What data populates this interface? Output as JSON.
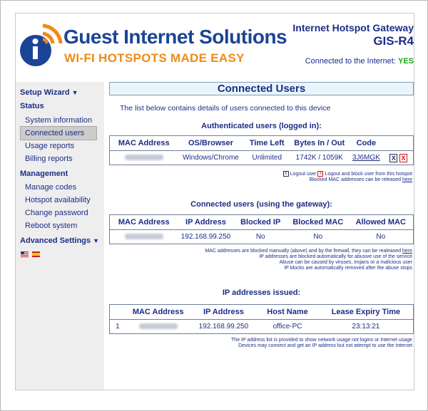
{
  "header": {
    "brand": "Guest Internet Solutions",
    "tagline": "WI-FI HOTSPOTS MADE EASY",
    "product": "Internet Hotspot Gateway",
    "model": "GIS-R4",
    "connected_label": "Connected to the Internet:",
    "connected_value": "YES"
  },
  "sidebar": {
    "setup_wizard": "Setup Wizard",
    "status_heading": "Status",
    "status_items": [
      "System information",
      "Connected users",
      "Usage reports",
      "Billing reports"
    ],
    "management_heading": "Management",
    "management_items": [
      "Manage codes",
      "Hotspot availability",
      "Change password",
      "Reboot system"
    ],
    "advanced": "Advanced Settings"
  },
  "page": {
    "title": "Connected Users",
    "intro": "The list below contains details of users connected to this device"
  },
  "authenticated": {
    "heading": "Authenticated users (logged in):",
    "columns": [
      "MAC Address",
      "OS/Browser",
      "Time Left",
      "Bytes In / Out",
      "Code"
    ],
    "row": {
      "os": "Windows/Chrome",
      "time_left": "Unlimited",
      "bytes": "1742K / 1059K",
      "code": "3J6MGK"
    },
    "note_logout": "Logout user",
    "note_block": "Logout and block user from this hotspot",
    "note_released": "Blocked MAC addresses can be released",
    "note_link": "here"
  },
  "gateway": {
    "heading": "Connected users (using the gateway):",
    "columns": [
      "MAC Address",
      "IP Address",
      "Blocked IP",
      "Blocked MAC",
      "Allowed MAC"
    ],
    "row": {
      "ip": "192.168.99.250",
      "blocked_ip": "No",
      "blocked_mac": "No",
      "allowed_mac": "No"
    },
    "notes": [
      "MAC addresses are blocked manually (above) and by the firewall, they can be realeased",
      "IP addresses are blocked automatically for abusive use of the service",
      "Abuse can be caused by viruses, trojans or a malicious user",
      "IP blocks are automatically removed after the abuse stops"
    ],
    "note_link": "here"
  },
  "issued": {
    "heading": "IP addresses issued:",
    "columns": [
      "MAC Address",
      "IP Address",
      "Host Name",
      "Lease Expiry Time"
    ],
    "row": {
      "index": "1",
      "ip": "192.168.99.250",
      "host": "office-PC",
      "expiry": "23:13:21"
    },
    "notes": [
      "The IP address list is provided to show network usage not logins or Internet usage",
      "Devices may connect and get an IP address but not attempt to use the Internet"
    ]
  },
  "icons": {
    "logout": "X",
    "block": "X",
    "accent_blue": "#1c2d86",
    "accent_orange": "#f08a16",
    "status_green": "#1aa31a"
  }
}
